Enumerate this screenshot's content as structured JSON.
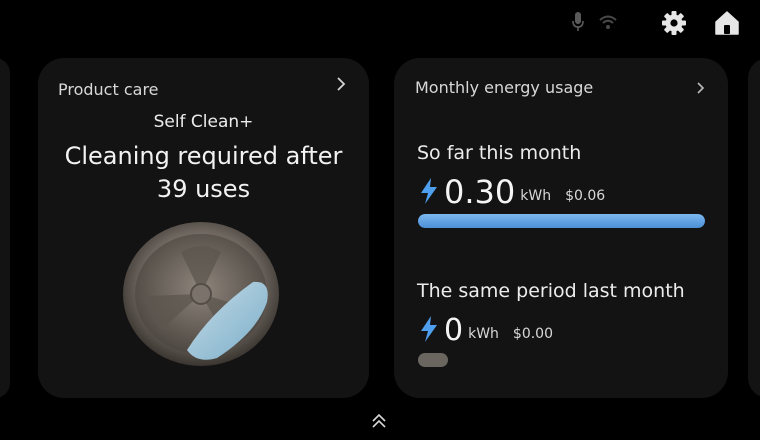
{
  "product_care": {
    "title": "Product care",
    "program": "Self Clean+",
    "status_line1": "Cleaning required after",
    "status_line2": "39 uses"
  },
  "energy": {
    "title": "Monthly energy usage",
    "this_month": {
      "label": "So far this month",
      "value": "0.30",
      "unit": "kWh",
      "cost": "$0.06",
      "bar_fill_fraction": 1.0
    },
    "last_month": {
      "label": "The same period last month",
      "value": "0",
      "unit": "kWh",
      "cost": "$0.00"
    }
  },
  "icons": {
    "topbar": [
      "microphone-icon",
      "wifi-icon",
      "settings-icon",
      "home-icon"
    ],
    "card_nav": "chevron-right-icon",
    "energy": "lightning-bolt-icon",
    "pager": "double-chevron-up-icon"
  },
  "colors": {
    "accent_blue": "#5a9ee2",
    "card_bg": "#131313",
    "bolt": "#4ea0ee"
  }
}
